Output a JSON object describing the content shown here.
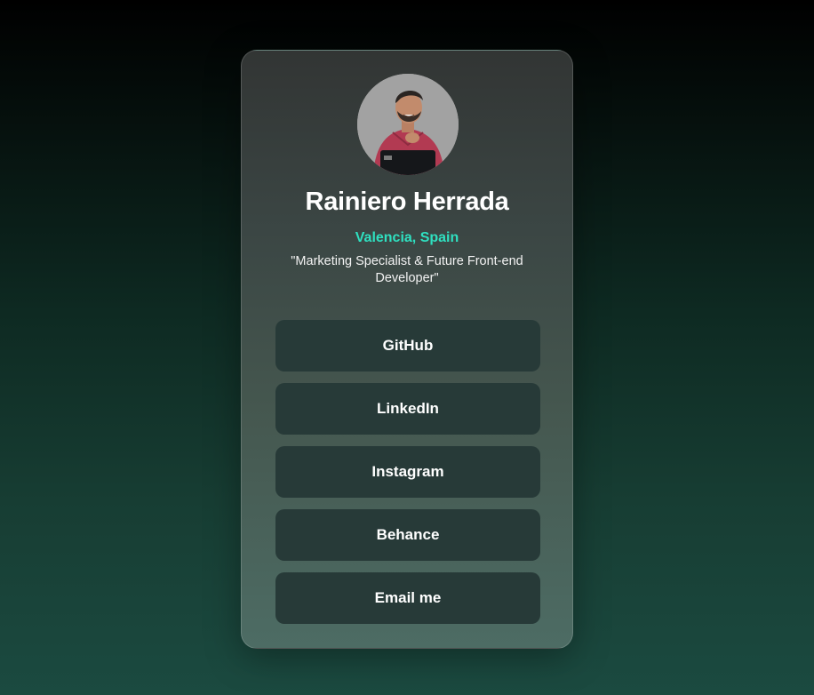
{
  "profile": {
    "name": "Rainiero Herrada",
    "location": "Valencia, Spain",
    "bio": "\"Marketing Specialist & Future Front-end Developer\""
  },
  "links": [
    {
      "label": "GitHub"
    },
    {
      "label": "LinkedIn"
    },
    {
      "label": "Instagram"
    },
    {
      "label": "Behance"
    },
    {
      "label": "Email me"
    }
  ],
  "colors": {
    "accent": "#2fe0c0",
    "button_bg": "#273a38"
  }
}
